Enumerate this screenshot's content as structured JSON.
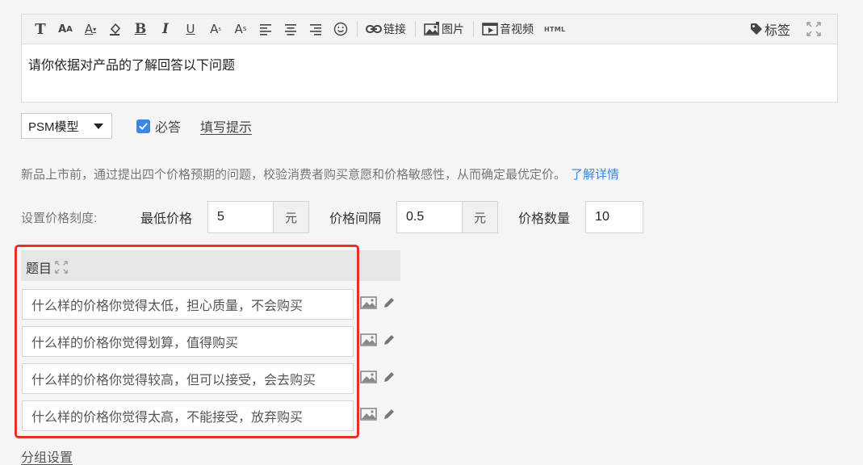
{
  "editor": {
    "toolbar": {
      "link_label": "链接",
      "image_label": "图片",
      "av_label": "音视频",
      "html_label": "HTML",
      "tag_label": "标签"
    },
    "content": "请你依据对产品的了解回答以下问题"
  },
  "question_type": {
    "selected": "PSM模型"
  },
  "required": {
    "label": "必答",
    "checked": true
  },
  "hint_link": "填写提示",
  "description": {
    "text": "新品上市前，通过提出四个价格预期的问题，校验消费者购买意愿和价格敏感性，从而确定最优定价。",
    "more_link": "了解详情"
  },
  "price_scale": {
    "label": "设置价格刻度:",
    "min_label": "最低价格",
    "min_value": "5",
    "min_unit": "元",
    "interval_label": "价格间隔",
    "interval_value": "0.5",
    "interval_unit": "元",
    "count_label": "价格数量",
    "count_value": "10"
  },
  "questions": {
    "header": "题目",
    "items": [
      "什么样的价格你觉得太低，担心质量，不会购买",
      "什么样的价格你觉得划算，值得购买",
      "什么样的价格你觉得较高，但可以接受，会去购买",
      "什么样的价格你觉得太高，不能接受，放弃购买"
    ]
  },
  "group_settings": "分组设置",
  "colors": {
    "accent": "#3a86e0",
    "highlight": "#e63030"
  }
}
